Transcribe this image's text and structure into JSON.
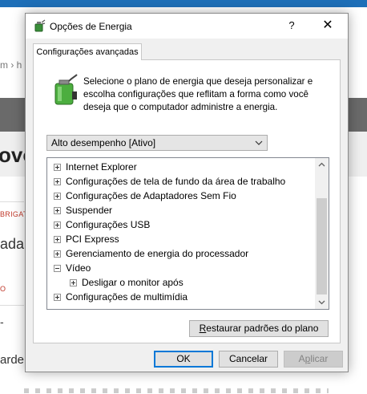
{
  "background": {
    "crumb": "m  ›  h",
    "heading_fragment": "ovo",
    "red_label_1": "BRIGAT",
    "text_fragment_1": "ada",
    "red_label_2": "O",
    "dash": "-",
    "text_fragment_2": "arde,"
  },
  "dialog": {
    "title": "Opções de Energia",
    "help": "?",
    "close": "✕",
    "tab_label": "Configurações avançadas",
    "description": "Selecione o plano de energia que deseja personalizar e escolha configurações que reflitam a forma como você deseja que o computador administre a energia.",
    "selected_plan": "Alto desempenho [Ativo]",
    "tree": [
      {
        "label": "Internet Explorer",
        "state": "collapsed",
        "level": 0
      },
      {
        "label": "Configurações de tela de fundo da área de trabalho",
        "state": "collapsed",
        "level": 0
      },
      {
        "label": "Configurações de Adaptadores Sem Fio",
        "state": "collapsed",
        "level": 0
      },
      {
        "label": "Suspender",
        "state": "collapsed",
        "level": 0
      },
      {
        "label": "Configurações USB",
        "state": "collapsed",
        "level": 0
      },
      {
        "label": "PCI Express",
        "state": "collapsed",
        "level": 0
      },
      {
        "label": "Gerenciamento de energia do processador",
        "state": "collapsed",
        "level": 0
      },
      {
        "label": "Vídeo",
        "state": "expanded",
        "level": 0
      },
      {
        "label": "Desligar o monitor após",
        "state": "collapsed",
        "level": 1
      },
      {
        "label": "Configurações de multimídia",
        "state": "collapsed",
        "level": 0
      }
    ],
    "restore_button": "Restaurar padrões do plano",
    "ok_button": "OK",
    "cancel_button": "Cancelar",
    "apply_button": "Aplicar",
    "accent_color": "#0078d7",
    "icons": [
      "power-options-icon",
      "battery-plug-icon",
      "expand-icon",
      "collapse-icon",
      "chevron-down-icon"
    ]
  }
}
